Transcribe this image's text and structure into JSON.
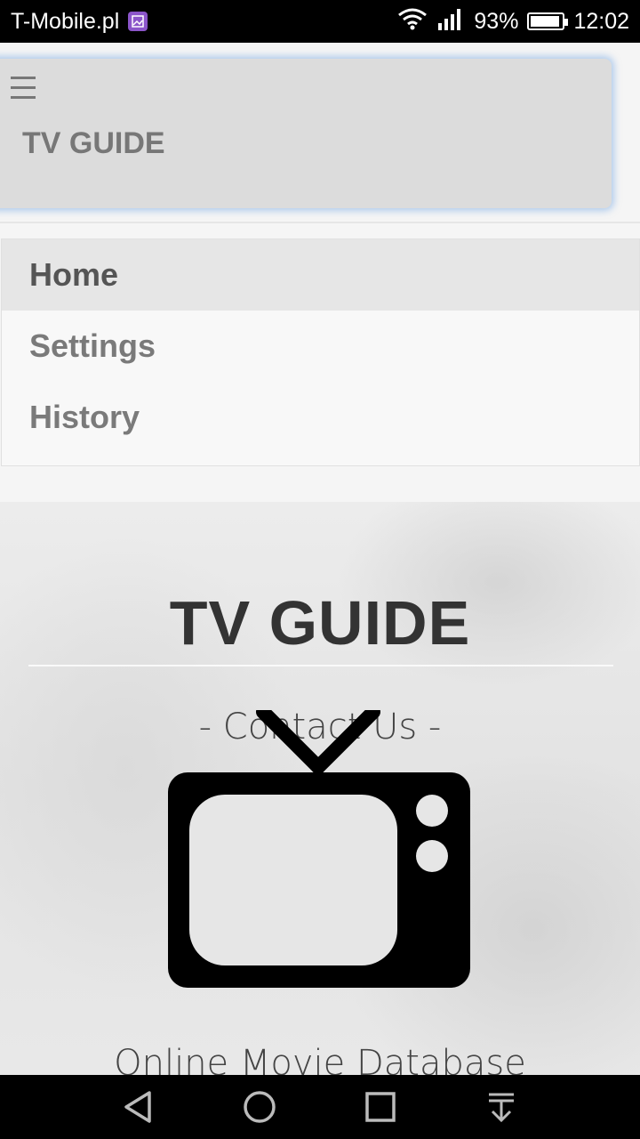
{
  "status_bar": {
    "carrier": "T-Mobile.pl",
    "battery": "93%",
    "battery_level": 0.93,
    "time": "12:02"
  },
  "header": {
    "title": "TV GUIDE",
    "menu_icon": "hamburger-icon"
  },
  "menu": {
    "items": [
      {
        "label": "Home",
        "active": true
      },
      {
        "label": "Settings",
        "active": false
      },
      {
        "label": "History",
        "active": false
      }
    ]
  },
  "hero": {
    "title": "TV GUIDE",
    "subtitle": "- Contact Us -",
    "tagline": "Online Movie Database",
    "icon": "tv-icon"
  },
  "nav_bar": {
    "icons": [
      "back-icon",
      "home-icon",
      "recents-icon",
      "notifications-pull-icon"
    ]
  }
}
